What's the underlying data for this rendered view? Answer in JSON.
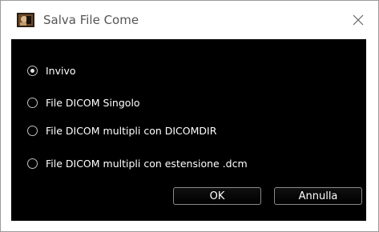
{
  "window": {
    "title": "Salva File Come",
    "icon": "app-photo-icon",
    "close_icon": "close-icon"
  },
  "options": [
    {
      "label": "Invivo",
      "selected": true
    },
    {
      "label": "File DICOM Singolo",
      "selected": false
    },
    {
      "label": "File DICOM multipli con DICOMDIR",
      "selected": false
    },
    {
      "label": "File DICOM multipli con estensione .dcm",
      "selected": false
    }
  ],
  "buttons": {
    "ok_label": "OK",
    "cancel_label": "Annulla"
  },
  "colors": {
    "content_background": "#000000",
    "title_text": "#555555",
    "option_text": "#ffffff"
  }
}
